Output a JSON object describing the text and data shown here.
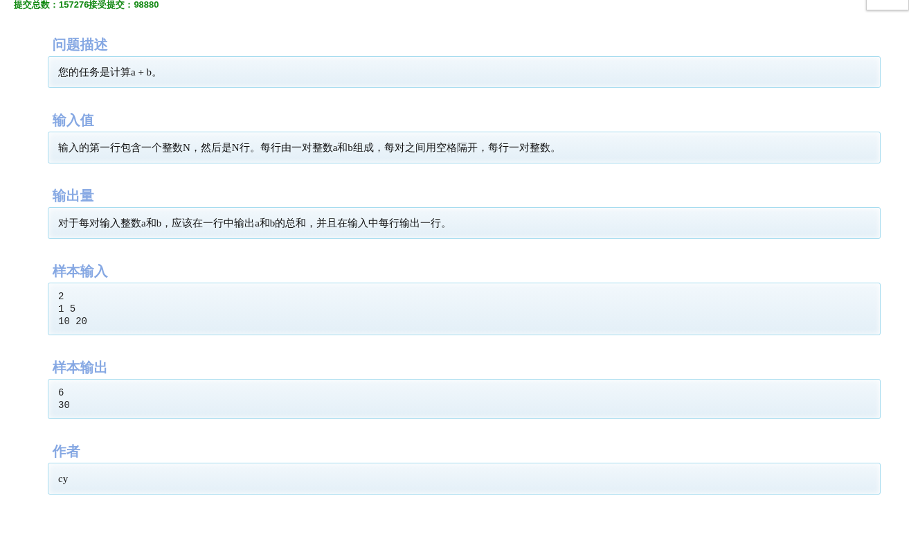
{
  "stats": "提交总数：157276接受提交：98880",
  "sections": [
    {
      "heading": "问题描述",
      "kind": "text",
      "lines": [
        "您的任务是计算a + b。"
      ]
    },
    {
      "heading": "输入值",
      "kind": "text",
      "lines": [
        "输入的第一行包含一个整数N，然后是N行。每行由一对整数a和b组成，每对之间用空格隔开，每行一对整数。"
      ]
    },
    {
      "heading": "输出量",
      "kind": "text",
      "lines": [
        "对于每对输入整数a和b，应该在一行中输出a和b的总和，并且在输入中每行输出一行。"
      ]
    },
    {
      "heading": "样本输入",
      "kind": "code",
      "lines": [
        "2",
        "1 5",
        "10 20"
      ]
    },
    {
      "heading": "样本输出",
      "kind": "code",
      "lines": [
        "6",
        "30"
      ]
    },
    {
      "heading": "作者",
      "kind": "text",
      "lines": [
        "cy"
      ]
    }
  ]
}
